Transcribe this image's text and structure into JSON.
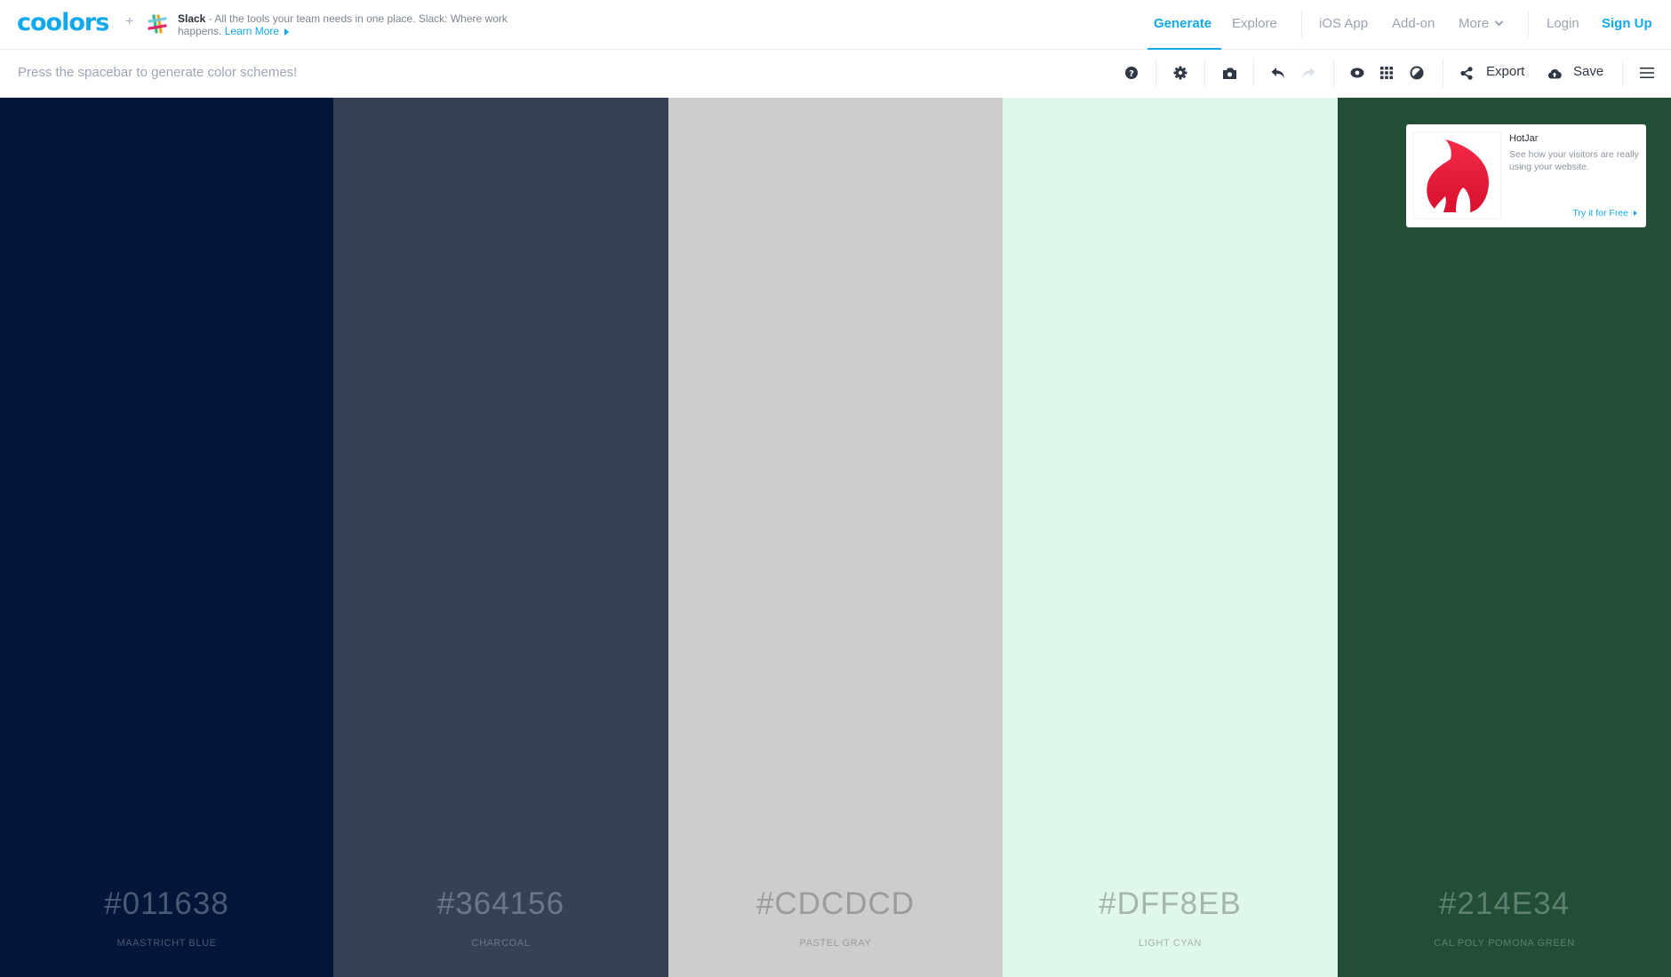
{
  "header": {
    "logo": "coolors",
    "plus": "+",
    "ad": {
      "brand": "Slack",
      "text": " - All the tools your team needs in one place. Slack: Where work happens. ",
      "link": "Learn More"
    },
    "nav": {
      "generate": "Generate",
      "explore": "Explore",
      "ios_app": "iOS App",
      "addon": "Add-on",
      "more": "More",
      "login": "Login",
      "signup": "Sign Up"
    }
  },
  "toolbar": {
    "hint": "Press the spacebar to generate color schemes!",
    "icons": [
      "help-icon",
      "settings-icon",
      "camera-icon",
      "undo-icon",
      "redo-icon",
      "eye-icon",
      "grid-icon",
      "contrast-icon",
      "share-icon",
      "cloud-upload-icon",
      "menu-icon"
    ],
    "export_label": "Export",
    "save_label": "Save"
  },
  "palette": [
    {
      "hex": "#011638",
      "name": "MAASTRICHT BLUE",
      "bg": "#011638",
      "text": "#4a5a74"
    },
    {
      "hex": "#364156",
      "name": "CHARCOAL",
      "bg": "#364156",
      "text": "#6d7789"
    },
    {
      "hex": "#CDCDCD",
      "name": "PASTEL GRAY",
      "bg": "#cdcdcd",
      "text": "#9a9b9f"
    },
    {
      "hex": "#DFF8EB",
      "name": "LIGHT CYAN",
      "bg": "#dff8eb",
      "text": "#a4b6ae"
    },
    {
      "hex": "#214E34",
      "name": "CAL POLY POMONA GREEN",
      "bg": "#214e34",
      "text": "#5f8070"
    }
  ],
  "adcard": {
    "title": "HotJar",
    "description": "See how your visitors are really using your website.",
    "cta": "Try it for Free"
  },
  "colors": {
    "accent": "#11a8ec",
    "icon": "#2f3644",
    "icon_disabled": "#dde2e8"
  }
}
